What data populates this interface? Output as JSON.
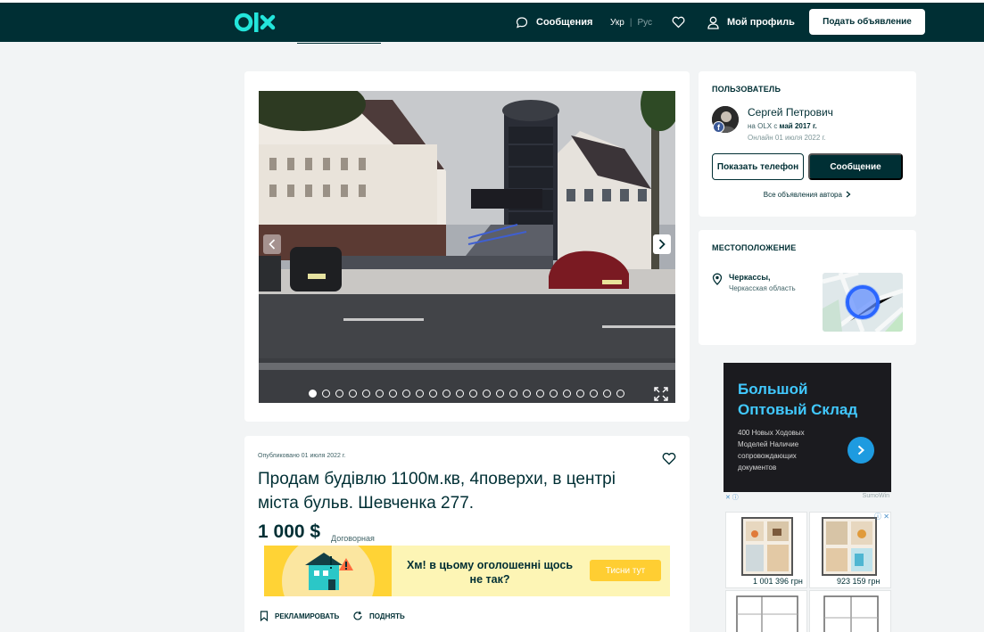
{
  "header": {
    "logo": "OLX",
    "messages": "Сообщения",
    "lang_uk": "Укр",
    "lang_ru": "Рус",
    "profile": "Мой профиль",
    "post_ad": "Подать объявление"
  },
  "gallery": {
    "photo_count": 24,
    "active_index": 0
  },
  "user": {
    "section_title": "ПОЛЬЗОВАТЕЛЬ",
    "name": "Сергей Петрович",
    "since_prefix": "на OLX с ",
    "since_date": "май 2017 г.",
    "online": "Онлайн 01 июля 2022 г.",
    "show_phone": "Показать телефон",
    "message": "Сообщение",
    "all_ads": "Все объявления автора"
  },
  "location": {
    "section_title": "МЕСТОПОЛОЖЕНИЕ",
    "city": "Черкассы,",
    "region": "Черкасская область"
  },
  "ad": {
    "title": "Большой Оптовый Склад",
    "text": "400 Новых Ходовых Моделей Наличие сопровождающих документов",
    "source": "SumoWin"
  },
  "thumbs": [
    {
      "price": "1 001 396 грн"
    },
    {
      "price": "923 159 грн"
    }
  ],
  "listing": {
    "published": "Опубликовано 01 июля 2022 г.",
    "title": "Продам будівлю 1100м.кв, 4поверхи, в центрі міста бульв. Шевченка 277.",
    "price": "1 000 $",
    "negotiable": "Договорная",
    "banner_text": "Хм! в цьому оголошенні щось не так?",
    "banner_button": "Тисни тут",
    "promote": "РЕКЛАМИРОВАТЬ",
    "raise": "ПОДНЯТЬ"
  },
  "colors": {
    "brand_dark": "#002f34",
    "brand_teal": "#23e5db",
    "banner_yellow": "#ffd335",
    "ad_blue": "#41c9ff"
  }
}
